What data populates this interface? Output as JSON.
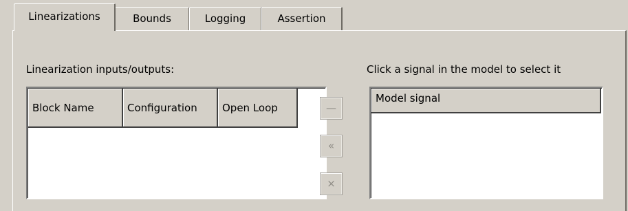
{
  "tabs": [
    {
      "label": "Linearizations",
      "selected": true
    },
    {
      "label": "Bounds",
      "selected": false
    },
    {
      "label": "Logging",
      "selected": false
    },
    {
      "label": "Assertion",
      "selected": false
    }
  ],
  "linearizations": {
    "io_label": "Linearization inputs/outputs:",
    "columns": [
      "Block Name",
      "Configuration",
      "Open Loop"
    ],
    "rows": []
  },
  "buttons": {
    "remove": {
      "glyph": "—",
      "enabled": false
    },
    "add": {
      "glyph": "«",
      "enabled": false
    },
    "delete": {
      "glyph": "×",
      "enabled": false
    }
  },
  "signal_picker": {
    "hint": "Click a signal in the model to select it",
    "column": "Model signal",
    "rows": []
  }
}
